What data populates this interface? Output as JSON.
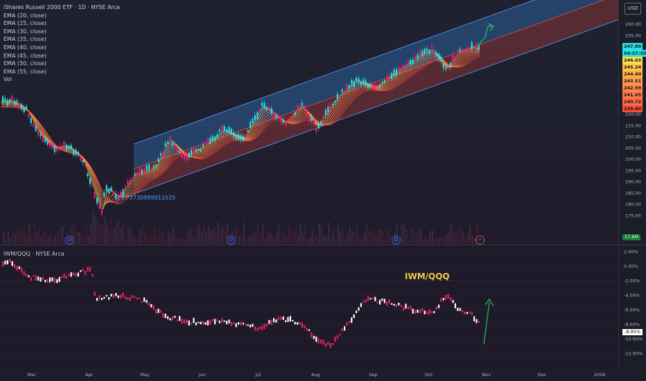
{
  "header": {
    "title": "iShares Russell 2000 ETF · 1D · NYSE Arca",
    "currency": "USD"
  },
  "legend": {
    "indicators": [
      "EMA (20, close)",
      "EMA (25, close)",
      "EMA (30, close)",
      "EMA (35, close)",
      "EMA (40, close)",
      "EMA (45, close)",
      "EMA (50, close)",
      "EMA (55, close)",
      "Vol"
    ]
  },
  "sub_legend": "IWM/QQQ · NYSE Arca",
  "annotations": {
    "low_value": "171.72730989911525",
    "ratio_label": "IWM/QQQ",
    "dividend_marker": "D",
    "earnings_marker": "⚡"
  },
  "price_tags": [
    {
      "value": "247.89",
      "bg": "#2ae0e8"
    },
    {
      "value": "04:37:35",
      "bg": "#2ae0e8"
    },
    {
      "value": "246.03",
      "bg": "#ffe04a"
    },
    {
      "value": "245.24",
      "bg": "#ffc94a"
    },
    {
      "value": "244.40",
      "bg": "#ffb04a"
    },
    {
      "value": "243.51",
      "bg": "#ff9a4a"
    },
    {
      "value": "242.59",
      "bg": "#ff8a4a"
    },
    {
      "value": "241.65",
      "bg": "#ff7a4a"
    },
    {
      "value": "240.72",
      "bg": "#ff6a4a"
    },
    {
      "value": "239.80",
      "bg": "#ff4d3a"
    }
  ],
  "volume_tag": "17.6M",
  "ratio_tag": "-8.95%",
  "colors": {
    "up": "#2ae0e8",
    "down": "#e91e78",
    "ratio_up": "#ffffff",
    "ratio_down": "#e91e63",
    "channel": "#2e6aa8",
    "arrow": "#22c55e"
  },
  "chart_data": [
    {
      "type": "candlestick",
      "title": "iShares Russell 2000 ETF · 1D · NYSE Arca",
      "x_ticks": [
        "Mar",
        "Apr",
        "May",
        "Jun",
        "Jul",
        "Aug",
        "Sep",
        "Oct",
        "Nov",
        "Dec",
        "2026"
      ],
      "y_ticks": [
        260,
        255,
        250,
        245,
        240,
        235,
        230,
        225,
        220,
        215,
        210,
        205,
        200,
        195,
        190,
        185,
        180,
        175
      ],
      "ylim": [
        172,
        262
      ],
      "series_close": [
        {
          "date": "2025-02-18",
          "close": 226
        },
        {
          "date": "2025-02-26",
          "close": 222
        },
        {
          "date": "2025-03-04",
          "close": 212
        },
        {
          "date": "2025-03-12",
          "close": 205
        },
        {
          "date": "2025-03-20",
          "close": 206
        },
        {
          "date": "2025-03-28",
          "close": 200
        },
        {
          "date": "2025-04-04",
          "close": 184
        },
        {
          "date": "2025-04-08",
          "close": 174
        },
        {
          "date": "2025-04-09",
          "close": 188
        },
        {
          "date": "2025-04-16",
          "close": 183
        },
        {
          "date": "2025-04-25",
          "close": 193
        },
        {
          "date": "2025-05-06",
          "close": 196
        },
        {
          "date": "2025-05-14",
          "close": 209
        },
        {
          "date": "2025-05-22",
          "close": 201
        },
        {
          "date": "2025-06-02",
          "close": 206
        },
        {
          "date": "2025-06-12",
          "close": 213
        },
        {
          "date": "2025-06-23",
          "close": 209
        },
        {
          "date": "2025-07-03",
          "close": 224
        },
        {
          "date": "2025-07-15",
          "close": 216
        },
        {
          "date": "2025-07-24",
          "close": 224
        },
        {
          "date": "2025-08-01",
          "close": 214
        },
        {
          "date": "2025-08-12",
          "close": 227
        },
        {
          "date": "2025-08-22",
          "close": 235
        },
        {
          "date": "2025-09-02",
          "close": 232
        },
        {
          "date": "2025-09-12",
          "close": 238
        },
        {
          "date": "2025-09-22",
          "close": 244
        },
        {
          "date": "2025-10-02",
          "close": 249
        },
        {
          "date": "2025-10-10",
          "close": 240
        },
        {
          "date": "2025-10-16",
          "close": 247
        },
        {
          "date": "2025-10-24",
          "close": 250
        },
        {
          "date": "2025-10-31",
          "close": 247.89
        }
      ]
    },
    {
      "type": "bar",
      "title": "IWM/QQQ · NYSE Arca",
      "y_ticks": [
        "2.00%",
        "0.00%",
        "-2.00%",
        "-4.00%",
        "-6.00%",
        "-8.00%",
        "-10.00%",
        "-12.00%"
      ],
      "ylim": [
        -13,
        2.3
      ],
      "series_pct": [
        {
          "date": "2025-02-18",
          "value": 0.5
        },
        {
          "date": "2025-02-28",
          "value": -1.5
        },
        {
          "date": "2025-03-12",
          "value": -2.0
        },
        {
          "date": "2025-03-24",
          "value": -1.0
        },
        {
          "date": "2025-04-02",
          "value": -0.5
        },
        {
          "date": "2025-04-04",
          "value": -4.5
        },
        {
          "date": "2025-04-16",
          "value": -4.0
        },
        {
          "date": "2025-04-30",
          "value": -4.8
        },
        {
          "date": "2025-05-12",
          "value": -7.0
        },
        {
          "date": "2025-05-28",
          "value": -7.8
        },
        {
          "date": "2025-06-12",
          "value": -7.5
        },
        {
          "date": "2025-06-30",
          "value": -8.5
        },
        {
          "date": "2025-07-14",
          "value": -7.2
        },
        {
          "date": "2025-07-24",
          "value": -8.0
        },
        {
          "date": "2025-08-01",
          "value": -10.0
        },
        {
          "date": "2025-08-08",
          "value": -11.0
        },
        {
          "date": "2025-08-18",
          "value": -8.0
        },
        {
          "date": "2025-08-28",
          "value": -4.5
        },
        {
          "date": "2025-09-08",
          "value": -5.0
        },
        {
          "date": "2025-09-22",
          "value": -6.0
        },
        {
          "date": "2025-10-02",
          "value": -6.5
        },
        {
          "date": "2025-10-10",
          "value": -4.0
        },
        {
          "date": "2025-10-17",
          "value": -6.0
        },
        {
          "date": "2025-10-24",
          "value": -6.8
        },
        {
          "date": "2025-10-31",
          "value": -8.95
        }
      ]
    }
  ]
}
